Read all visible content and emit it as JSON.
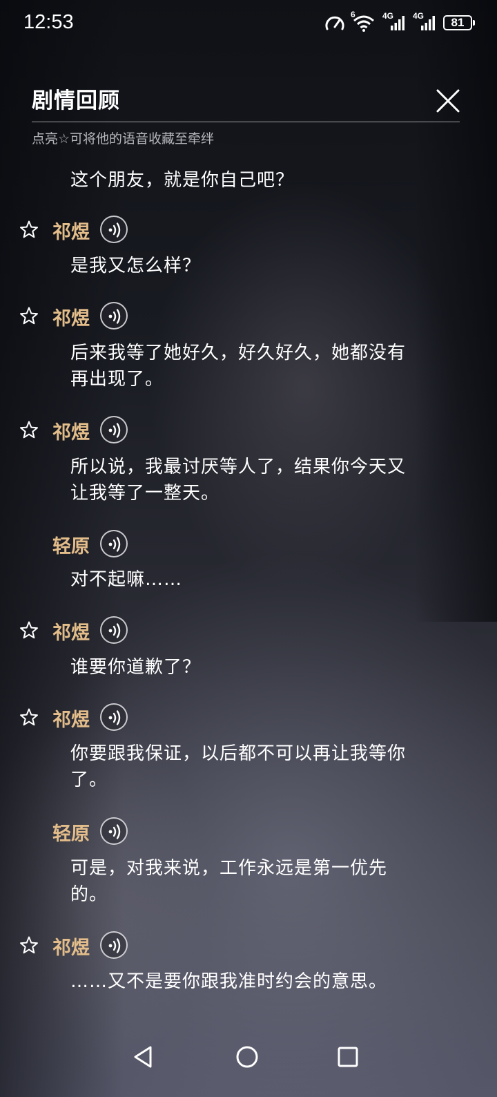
{
  "status_bar": {
    "time": "12:53",
    "network_label_1": "4G",
    "network_label_2": "4G",
    "wifi_label": "6",
    "battery": "81"
  },
  "header": {
    "title": "剧情回顾",
    "subtitle": "点亮☆可将他的语音收藏至牵绊",
    "close_icon": "close-icon"
  },
  "dialogue": [
    {
      "speaker": null,
      "text": [
        "这个朋友，就是你自己吧？"
      ]
    },
    {
      "speaker": "祁煜",
      "star": true,
      "text": [
        "是我又怎么样？"
      ]
    },
    {
      "speaker": "祁煜",
      "star": true,
      "text": [
        "后来我等了她好久，好久好久，她都没有",
        "再出现了。"
      ]
    },
    {
      "speaker": "祁煜",
      "star": true,
      "text": [
        "所以说，我最讨厌等人了，结果你今天又",
        "让我等了一整天。"
      ]
    },
    {
      "speaker": "轻原",
      "star": false,
      "text": [
        "对不起嘛……"
      ]
    },
    {
      "speaker": "祁煜",
      "star": true,
      "text": [
        "谁要你道歉了？"
      ]
    },
    {
      "speaker": "祁煜",
      "star": true,
      "text": [
        "你要跟我保证，以后都不可以再让我等你",
        "了。"
      ]
    },
    {
      "speaker": "轻原",
      "star": false,
      "text": [
        "可是，对我来说，工作永远是第一优先",
        "的。"
      ]
    },
    {
      "speaker": "祁煜",
      "star": true,
      "text": [
        "……又不是要你跟我准时约会的意思。"
      ]
    }
  ],
  "colors": {
    "speaker_name": "#e3bd8a",
    "text": "#ffffff"
  },
  "nav": {
    "back": "back-triangle-icon",
    "home": "home-circle-icon",
    "recent": "recent-square-icon"
  }
}
